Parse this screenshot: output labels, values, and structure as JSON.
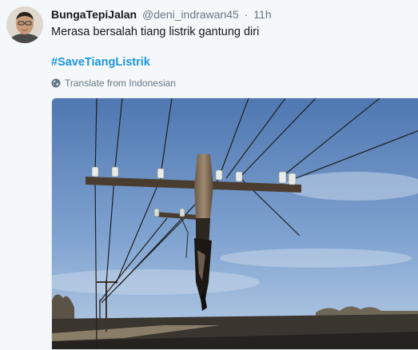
{
  "tweet": {
    "display_name": "BungaTepiJalan",
    "username": "@deni_indrawan45",
    "separator": "·",
    "timestamp": "11h",
    "text": "Merasa bersalah tiang listrik gantung diri",
    "hashtag": "#SaveTiangListrik",
    "translate_label": "Translate from Indonesian"
  },
  "icons": {
    "avatar": "profile-photo",
    "translate": "globe-icon"
  },
  "colors": {
    "background": "#f5f8fa",
    "text": "#14171a",
    "secondary": "#657786",
    "hashtag": "#1b95e0"
  }
}
